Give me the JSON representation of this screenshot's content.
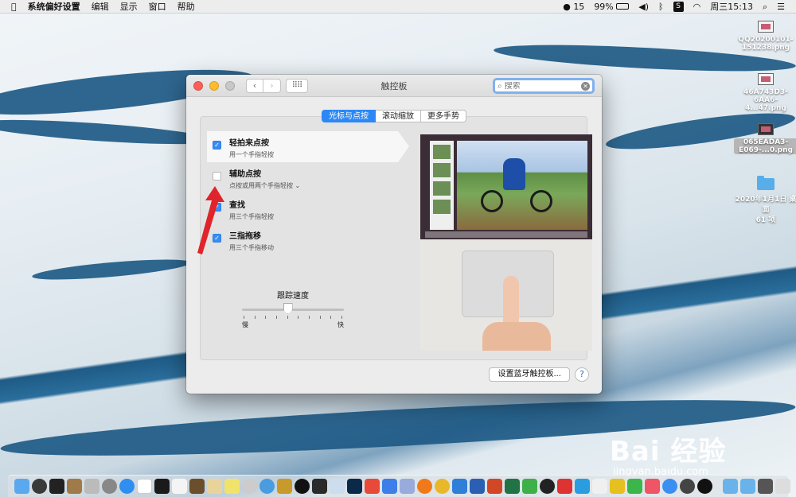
{
  "menubar": {
    "app_name": "系统偏好设置",
    "menus": [
      "编辑",
      "显示",
      "窗口",
      "帮助"
    ],
    "qq_count": "15",
    "battery": "99%",
    "clock": "周三15:13"
  },
  "desktop": {
    "items": [
      {
        "label": "QQ20200101-151238.png"
      },
      {
        "label": "46A743D3-6AA6-4...47.png"
      },
      {
        "label": "065EADA3-E069-...0.png"
      },
      {
        "label": "2020年1月1日 桌面",
        "sub": "61 项"
      }
    ]
  },
  "window": {
    "title": "触控板",
    "search_placeholder": "搜索",
    "tabs": [
      "光标与点按",
      "滚动缩放",
      "更多手势"
    ],
    "active_tab": 0,
    "options": [
      {
        "title": "轻拍来点按",
        "sub": "用一个手指轻按",
        "checked": true
      },
      {
        "title": "辅助点按",
        "sub": "点按或用两个手指轻按",
        "checked": false
      },
      {
        "title": "查找",
        "sub": "用三个手指轻按",
        "checked": true
      },
      {
        "title": "三指拖移",
        "sub": "用三个手指移动",
        "checked": true
      }
    ],
    "tracking_speed": {
      "label": "跟踪速度",
      "slow": "慢",
      "fast": "快",
      "value_fraction": 0.45
    },
    "setup_button": "设置蓝牙触控板...",
    "help": "?"
  },
  "watermark": {
    "brand": "Bai 经验",
    "url": "jingyan.baidu.com"
  },
  "colors": {
    "accent": "#2d88f5",
    "arrow": "#e0242b"
  }
}
